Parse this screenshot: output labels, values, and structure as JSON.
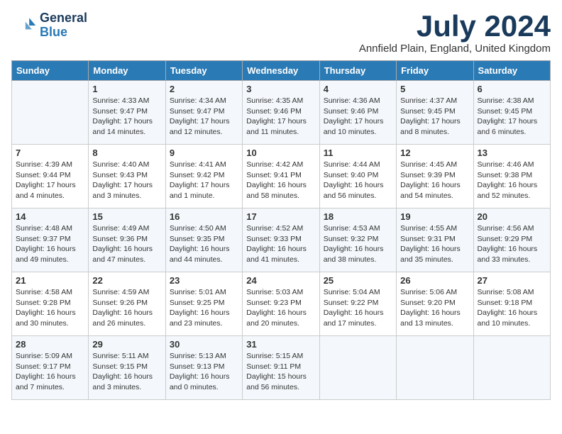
{
  "header": {
    "logo_line1": "General",
    "logo_line2": "Blue",
    "month_title": "July 2024",
    "location": "Annfield Plain, England, United Kingdom"
  },
  "weekdays": [
    "Sunday",
    "Monday",
    "Tuesday",
    "Wednesday",
    "Thursday",
    "Friday",
    "Saturday"
  ],
  "weeks": [
    [
      {
        "day": null
      },
      {
        "day": "1",
        "sunrise": "4:33 AM",
        "sunset": "9:47 PM",
        "daylight": "17 hours and 14 minutes."
      },
      {
        "day": "2",
        "sunrise": "4:34 AM",
        "sunset": "9:47 PM",
        "daylight": "17 hours and 12 minutes."
      },
      {
        "day": "3",
        "sunrise": "4:35 AM",
        "sunset": "9:46 PM",
        "daylight": "17 hours and 11 minutes."
      },
      {
        "day": "4",
        "sunrise": "4:36 AM",
        "sunset": "9:46 PM",
        "daylight": "17 hours and 10 minutes."
      },
      {
        "day": "5",
        "sunrise": "4:37 AM",
        "sunset": "9:45 PM",
        "daylight": "17 hours and 8 minutes."
      },
      {
        "day": "6",
        "sunrise": "4:38 AM",
        "sunset": "9:45 PM",
        "daylight": "17 hours and 6 minutes."
      }
    ],
    [
      {
        "day": "7",
        "sunrise": "4:39 AM",
        "sunset": "9:44 PM",
        "daylight": "17 hours and 4 minutes."
      },
      {
        "day": "8",
        "sunrise": "4:40 AM",
        "sunset": "9:43 PM",
        "daylight": "17 hours and 3 minutes."
      },
      {
        "day": "9",
        "sunrise": "4:41 AM",
        "sunset": "9:42 PM",
        "daylight": "17 hours and 1 minute."
      },
      {
        "day": "10",
        "sunrise": "4:42 AM",
        "sunset": "9:41 PM",
        "daylight": "16 hours and 58 minutes."
      },
      {
        "day": "11",
        "sunrise": "4:44 AM",
        "sunset": "9:40 PM",
        "daylight": "16 hours and 56 minutes."
      },
      {
        "day": "12",
        "sunrise": "4:45 AM",
        "sunset": "9:39 PM",
        "daylight": "16 hours and 54 minutes."
      },
      {
        "day": "13",
        "sunrise": "4:46 AM",
        "sunset": "9:38 PM",
        "daylight": "16 hours and 52 minutes."
      }
    ],
    [
      {
        "day": "14",
        "sunrise": "4:48 AM",
        "sunset": "9:37 PM",
        "daylight": "16 hours and 49 minutes."
      },
      {
        "day": "15",
        "sunrise": "4:49 AM",
        "sunset": "9:36 PM",
        "daylight": "16 hours and 47 minutes."
      },
      {
        "day": "16",
        "sunrise": "4:50 AM",
        "sunset": "9:35 PM",
        "daylight": "16 hours and 44 minutes."
      },
      {
        "day": "17",
        "sunrise": "4:52 AM",
        "sunset": "9:33 PM",
        "daylight": "16 hours and 41 minutes."
      },
      {
        "day": "18",
        "sunrise": "4:53 AM",
        "sunset": "9:32 PM",
        "daylight": "16 hours and 38 minutes."
      },
      {
        "day": "19",
        "sunrise": "4:55 AM",
        "sunset": "9:31 PM",
        "daylight": "16 hours and 35 minutes."
      },
      {
        "day": "20",
        "sunrise": "4:56 AM",
        "sunset": "9:29 PM",
        "daylight": "16 hours and 33 minutes."
      }
    ],
    [
      {
        "day": "21",
        "sunrise": "4:58 AM",
        "sunset": "9:28 PM",
        "daylight": "16 hours and 30 minutes."
      },
      {
        "day": "22",
        "sunrise": "4:59 AM",
        "sunset": "9:26 PM",
        "daylight": "16 hours and 26 minutes."
      },
      {
        "day": "23",
        "sunrise": "5:01 AM",
        "sunset": "9:25 PM",
        "daylight": "16 hours and 23 minutes."
      },
      {
        "day": "24",
        "sunrise": "5:03 AM",
        "sunset": "9:23 PM",
        "daylight": "16 hours and 20 minutes."
      },
      {
        "day": "25",
        "sunrise": "5:04 AM",
        "sunset": "9:22 PM",
        "daylight": "16 hours and 17 minutes."
      },
      {
        "day": "26",
        "sunrise": "5:06 AM",
        "sunset": "9:20 PM",
        "daylight": "16 hours and 13 minutes."
      },
      {
        "day": "27",
        "sunrise": "5:08 AM",
        "sunset": "9:18 PM",
        "daylight": "16 hours and 10 minutes."
      }
    ],
    [
      {
        "day": "28",
        "sunrise": "5:09 AM",
        "sunset": "9:17 PM",
        "daylight": "16 hours and 7 minutes."
      },
      {
        "day": "29",
        "sunrise": "5:11 AM",
        "sunset": "9:15 PM",
        "daylight": "16 hours and 3 minutes."
      },
      {
        "day": "30",
        "sunrise": "5:13 AM",
        "sunset": "9:13 PM",
        "daylight": "16 hours and 0 minutes."
      },
      {
        "day": "31",
        "sunrise": "5:15 AM",
        "sunset": "9:11 PM",
        "daylight": "15 hours and 56 minutes."
      },
      {
        "day": null
      },
      {
        "day": null
      },
      {
        "day": null
      }
    ]
  ]
}
